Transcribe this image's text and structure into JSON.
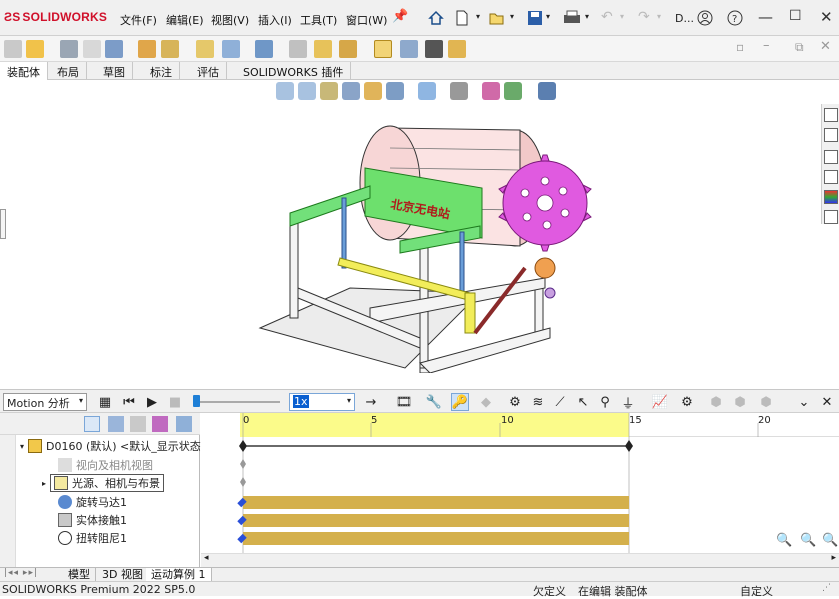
{
  "app": {
    "logo_text": "SOLIDWORKS",
    "user_initial": "D..."
  },
  "menu": {
    "items": [
      "文件(F)",
      "编辑(E)",
      "视图(V)",
      "插入(I)",
      "工具(T)",
      "窗口(W)"
    ]
  },
  "tabs": [
    "装配体",
    "布局",
    "草图",
    "标注",
    "评估",
    "SOLIDWORKS 插件"
  ],
  "model": {
    "banner_text": "北京无电站"
  },
  "motion": {
    "study_type": "Motion 分析",
    "speed": "1x",
    "ruler_ticks": [
      {
        "label": "0"
      },
      {
        "label": "5"
      },
      {
        "label": "10"
      },
      {
        "label": "15"
      },
      {
        "label": "20"
      }
    ]
  },
  "tree": {
    "root": "D0160 (默认) <默认_显示状态",
    "items": [
      {
        "label": "视向及相机视图",
        "grey": true
      },
      {
        "label": "光源、相机与布景",
        "boxed": true
      },
      {
        "label": "旋转马达1"
      },
      {
        "label": "实体接触1"
      },
      {
        "label": "扭转阻尼1"
      }
    ]
  },
  "bottom_tabs": [
    "模型",
    "3D 视图",
    "运动算例 1"
  ],
  "status": {
    "product": "SOLIDWORKS Premium 2022 SP5.0",
    "defined": "欠定义",
    "editing": "在编辑 装配体",
    "custom": "自定义"
  },
  "colors": {
    "timeline_ruler": "#fbfb8a",
    "motion_bar": "#d4b04c",
    "keypoint_blue": "#2a4fd8",
    "brand_red": "#d0102a"
  }
}
